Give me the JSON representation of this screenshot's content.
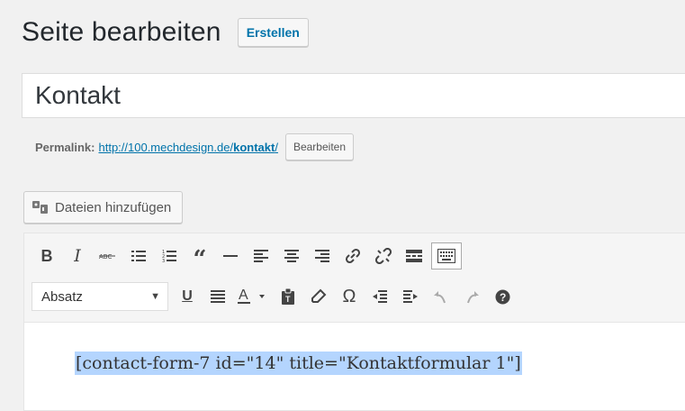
{
  "header": {
    "title": "Seite bearbeiten",
    "create_label": "Erstellen"
  },
  "title_field": {
    "value": "Kontakt"
  },
  "permalink": {
    "label": "Permalink:",
    "url_base": "http://100.mechdesign.de/",
    "slug": "kontakt",
    "slug_suffix": "/",
    "edit_label": "Bearbeiten"
  },
  "media": {
    "label": "Dateien hinzufügen",
    "icon": "media-upload-icon"
  },
  "toolbar": {
    "row1": [
      "bold-icon",
      "italic-icon",
      "strikethrough-icon",
      "bullet-list-icon",
      "numbered-list-icon",
      "blockquote-icon",
      "horizontal-rule-icon",
      "align-left-icon",
      "align-center-icon",
      "align-right-icon",
      "link-icon",
      "unlink-icon",
      "read-more-icon",
      "toolbar-toggle-icon"
    ],
    "format_select": "Absatz",
    "row2": [
      "underline-icon",
      "justify-icon",
      "text-color-icon",
      "paste-text-icon",
      "clear-formatting-icon",
      "special-character-icon",
      "outdent-icon",
      "indent-icon",
      "undo-icon",
      "redo-icon",
      "help-icon"
    ]
  },
  "editor": {
    "content": "[contact-form-7 id=\"14\" title=\"Kontaktformular 1\"]",
    "selection_color": "#b4d5fe"
  },
  "colors": {
    "link": "#0073aa",
    "background": "#f1f1f1"
  }
}
